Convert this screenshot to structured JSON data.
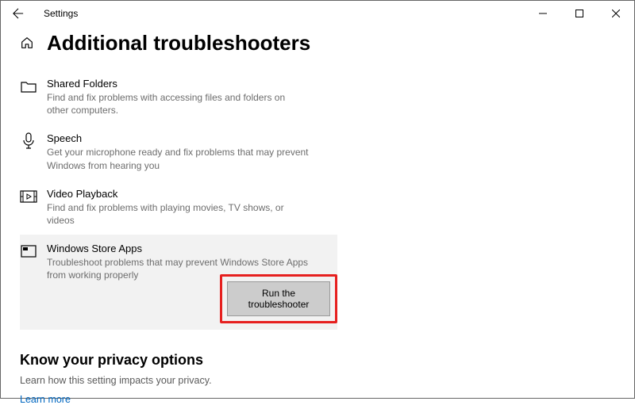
{
  "window": {
    "title": "Settings"
  },
  "page": {
    "heading": "Additional troubleshooters"
  },
  "troubleshooters": [
    {
      "name": "Shared Folders",
      "desc": "Find and fix problems with accessing files and folders on other computers."
    },
    {
      "name": "Speech",
      "desc": "Get your microphone ready and fix problems that may prevent Windows from hearing you"
    },
    {
      "name": "Video Playback",
      "desc": "Find and fix problems with playing movies, TV shows, or videos"
    },
    {
      "name": "Windows Store Apps",
      "desc": "Troubleshoot problems that may prevent Windows Store Apps from working properly"
    }
  ],
  "action": {
    "run_label": "Run the troubleshooter"
  },
  "privacy": {
    "heading": "Know your privacy options",
    "sub": "Learn how this setting impacts your privacy.",
    "link": "Learn more"
  }
}
